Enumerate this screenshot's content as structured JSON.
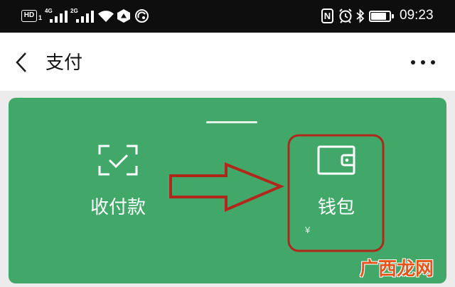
{
  "status_bar": {
    "hd_label": "HD",
    "sim_slot": "1",
    "network_1": "4G",
    "signal_1": 4,
    "network_2": "2G",
    "signal_2": 4,
    "nfc_label": "N",
    "battery_level": 0.85,
    "time": "09:23",
    "icons": [
      "wifi-icon",
      "hexagon-icon",
      "hotspot-icon",
      "nfc-icon",
      "alarm-icon",
      "bluetooth-icon",
      "battery-icon"
    ]
  },
  "header": {
    "title": "支付",
    "back_icon": "back-arrow-icon",
    "more_icon": "more-icon"
  },
  "pay_card": {
    "background": "#42A86A",
    "items": [
      {
        "label": "收付款",
        "icon": "scan-pay-icon"
      },
      {
        "label": "钱包",
        "icon": "wallet-icon",
        "balance_symbol": "¥"
      }
    ]
  },
  "annotation": {
    "color": "#B0281C"
  },
  "watermark": {
    "text": "广西龙网",
    "color": "#E5541A"
  },
  "colors": {
    "status_bar": "#0E0E0E",
    "header": "#FFFFFF",
    "page_background": "#ECECEC"
  }
}
